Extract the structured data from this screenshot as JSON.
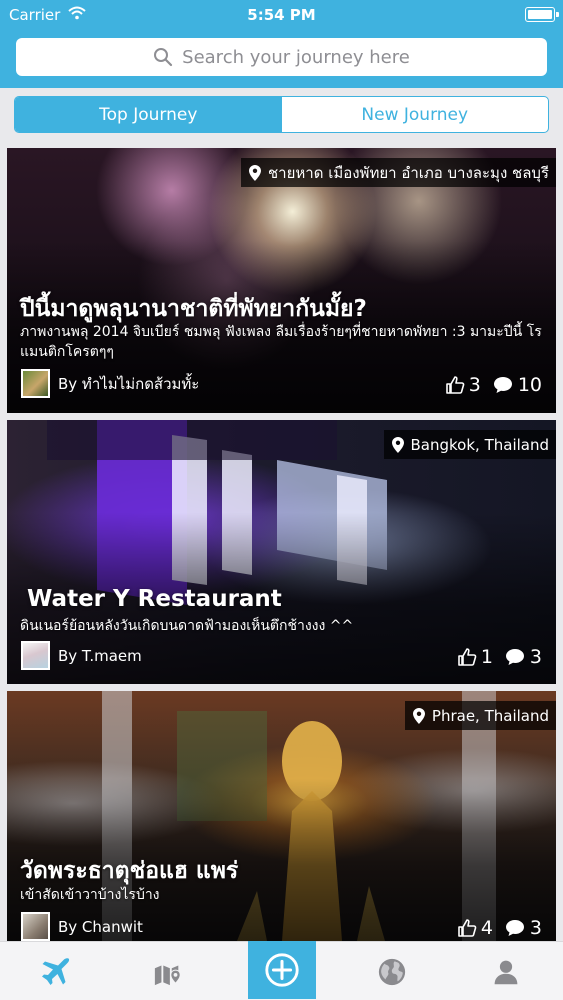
{
  "status_bar": {
    "carrier": "Carrier",
    "time": "5:54 PM"
  },
  "search": {
    "placeholder": "Search your journey here"
  },
  "segments": {
    "top": "Top Journey",
    "new": "New Journey"
  },
  "colors": {
    "accent": "#3fb2df",
    "tab_active": "#3fb2df",
    "tab_inactive": "#8a8a8e"
  },
  "cards": [
    {
      "location": "ชายหาด เมืองพัทยา อำเภอ บางละมุง ชลบุรี",
      "title": "ปีนี้มาดูพลุนานาชาติที่พัทยากันมั้ย?",
      "description": "ภาพงานพลุ 2014 จิบเบียร์ ชมพลุ ฟังเพลง ลืมเรื่องร้ายๆที่ชายหาดพัทยา :3 มามะปีนี้ โรแมนติกโครตๆๆ",
      "author": "By ทำไมไม่กดส้วมทั้ะ",
      "likes": "3",
      "comments": "10"
    },
    {
      "location": "Bangkok, Thailand",
      "title": "Water Y Restaurant",
      "description": "ดินเนอร์ย้อนหลังวันเกิดบนดาดฟ้ามองเห็นตึกช้างงง ^^",
      "author": "By T.maem",
      "likes": "1",
      "comments": "3"
    },
    {
      "location": "Phrae, Thailand",
      "title": "วัดพระธาตุช่อแฮ แพร่",
      "description": "เข้าสัดเข้าวาบ้างไรบ้าง",
      "author": "By Chanwit",
      "likes": "4",
      "comments": "3"
    }
  ],
  "tabbar": {
    "items": [
      "plane-icon",
      "map-pin-icon",
      "add-icon",
      "globe-icon",
      "profile-icon"
    ],
    "active": "plane-icon"
  }
}
